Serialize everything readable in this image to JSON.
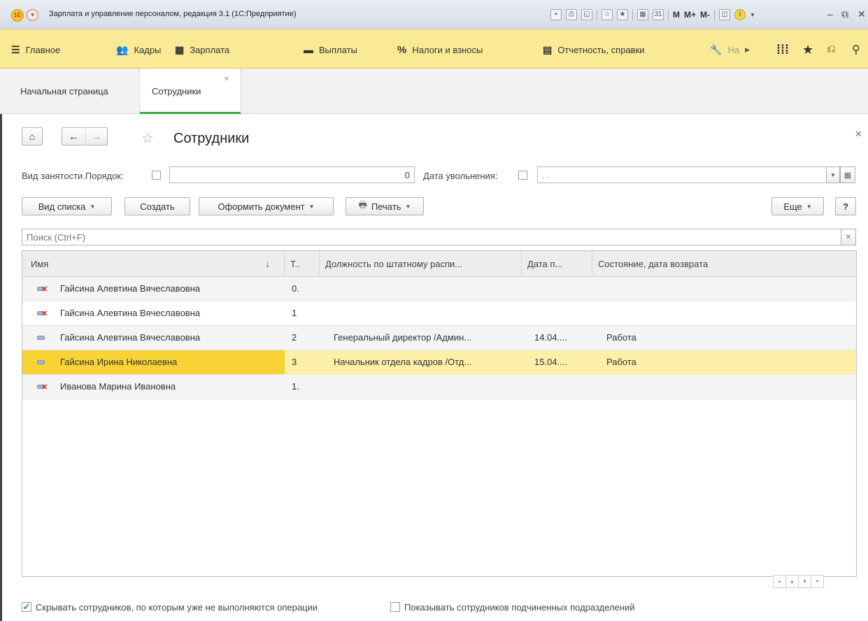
{
  "app": {
    "title": "Зарплата и управление персоналом, редакция 3.1  (1С:Предприятие)",
    "logo_text": "1С",
    "toolbar_m": "M",
    "toolbar_mplus": "M+",
    "toolbar_mminus": "M-",
    "toolbar_cal": "31"
  },
  "nav": {
    "items": [
      {
        "label": "Главное",
        "icon": "menu-lines-icon"
      },
      {
        "label": "Кадры",
        "icon": "people-icon"
      },
      {
        "label": "Зарплата",
        "icon": "calculator-icon"
      },
      {
        "label": "Выплаты",
        "icon": "card-icon"
      },
      {
        "label": "Налоги и взносы",
        "icon": "percent-icon"
      },
      {
        "label": "Отчетность, справки",
        "icon": "report-icon"
      },
      {
        "label": "На",
        "icon": "wrench-icon"
      }
    ]
  },
  "tabs": [
    {
      "label": "Начальная страница"
    },
    {
      "label": "Сотрудники",
      "active": true
    }
  ],
  "form": {
    "title": "Сотрудники",
    "filter_employment_label": "Вид занятости.Порядок:",
    "filter_employment_value": "0",
    "filter_dismissal_label": "Дата увольнения:",
    "filter_dismissal_value": ". .",
    "search_placeholder": "Поиск (Ctrl+F)"
  },
  "toolbar": {
    "list_view": "Вид списка",
    "create": "Создать",
    "make_document": "Оформить документ",
    "print": "Печать",
    "more": "Еще",
    "help": "?"
  },
  "table": {
    "columns": [
      "Имя",
      "Т..",
      "Должность по штатному распи...",
      "Дата п...",
      "Состояние, дата возврата"
    ],
    "rows": [
      {
        "name": "Гайсина Алевтина Вячеславовна",
        "t": "0.",
        "position": "",
        "date": "",
        "state": "",
        "icon": "employee-dismissed-icon"
      },
      {
        "name": "Гайсина Алевтина Вячеславовна",
        "t": "1",
        "position": "",
        "date": "",
        "state": "",
        "icon": "employee-dismissed-icon"
      },
      {
        "name": "Гайсина Алевтина Вячеславовна",
        "t": "2",
        "position": "Генеральный директор /Админ...",
        "date": "14.04....",
        "state": "Работа",
        "icon": "employee-icon"
      },
      {
        "name": "Гайсина Ирина Николаевна",
        "t": "3",
        "position": "Начальник отдела кадров /Отд...",
        "date": "15.04....",
        "state": "Работа",
        "icon": "employee-icon",
        "selected": true
      },
      {
        "name": "Иванова Марина Ивановна",
        "t": "1.",
        "position": "",
        "date": "",
        "state": "",
        "icon": "employee-dismissed-icon"
      }
    ]
  },
  "footer": {
    "hide_inactive_label": "Скрывать сотрудников, по которым уже не выполняются операции",
    "hide_inactive_checked": true,
    "show_subordinate_label": "Показывать сотрудников подчиненных подразделений",
    "show_subordinate_checked": false
  },
  "colors": {
    "navbar": "#fbea95",
    "selected_row": "#fcf0a8",
    "selected_cell": "#f7d335",
    "active_tab_underline": "#3cab3c"
  }
}
